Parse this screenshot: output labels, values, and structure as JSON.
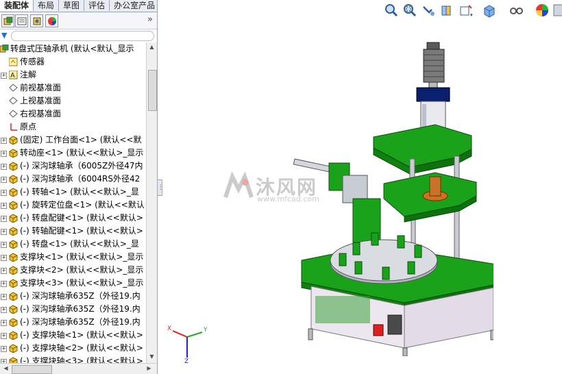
{
  "tabs": [
    {
      "label": "装配体",
      "active": true
    },
    {
      "label": "布局",
      "active": false
    },
    {
      "label": "草图",
      "active": false
    },
    {
      "label": "评估",
      "active": false
    },
    {
      "label": "办公室产品",
      "active": false
    }
  ],
  "panel_more": "»",
  "tree": [
    {
      "label": "转盘式压轴承机 (默认<默认_显示",
      "icon": "assembly-icon",
      "expand": "",
      "indent": 0
    },
    {
      "label": "传感器",
      "icon": "sensor-icon",
      "expand": "",
      "indent": 1
    },
    {
      "label": "注解",
      "icon": "annotation-icon",
      "expand": "+",
      "indent": 1
    },
    {
      "label": "前视基准面",
      "icon": "plane-icon",
      "expand": "",
      "indent": 1
    },
    {
      "label": "上视基准面",
      "icon": "plane-icon",
      "expand": "",
      "indent": 1
    },
    {
      "label": "右视基准面",
      "icon": "plane-icon",
      "expand": "",
      "indent": 1
    },
    {
      "label": "原点",
      "icon": "origin-icon",
      "expand": "",
      "indent": 1
    },
    {
      "label": "(固定) 工作台面<1> (默认<<默",
      "icon": "part-icon",
      "expand": "+",
      "indent": 1
    },
    {
      "label": "转动座<1> (默认<<默认>_显示",
      "icon": "part-icon",
      "expand": "+",
      "indent": 1
    },
    {
      "label": "(-) 深沟球轴承（6005Z外径47内",
      "icon": "part-icon",
      "expand": "+",
      "indent": 1
    },
    {
      "label": "(-) 深沟球轴承（6004RS外径42",
      "icon": "part-icon",
      "expand": "+",
      "indent": 1
    },
    {
      "label": "(-) 转轴<1> (默认<<默认>_显",
      "icon": "part-icon",
      "expand": "+",
      "indent": 1
    },
    {
      "label": "(-) 旋转定位盘<1> (默认<<默认",
      "icon": "part-icon",
      "expand": "+",
      "indent": 1
    },
    {
      "label": "(-) 转盘配键<1> (默认<<默认>",
      "icon": "part-icon",
      "expand": "+",
      "indent": 1
    },
    {
      "label": "(-) 转轴配键<1> (默认<<默认>",
      "icon": "part-icon",
      "expand": "+",
      "indent": 1
    },
    {
      "label": "(-) 转盘<1> (默认<<默认>_显",
      "icon": "part-icon",
      "expand": "+",
      "indent": 1
    },
    {
      "label": "支撑块<1> (默认<<默认>_显示",
      "icon": "part-icon",
      "expand": "+",
      "indent": 1
    },
    {
      "label": "支撑块<2> (默认<<默认>_显示",
      "icon": "part-icon",
      "expand": "+",
      "indent": 1
    },
    {
      "label": "支撑块<3> (默认<<默认>_显示",
      "icon": "part-icon",
      "expand": "+",
      "indent": 1
    },
    {
      "label": "(-) 深沟球轴承635Z（外径19.内",
      "icon": "part-icon",
      "expand": "+",
      "indent": 1
    },
    {
      "label": "(-) 深沟球轴承635Z（外径19.内",
      "icon": "part-icon",
      "expand": "+",
      "indent": 1
    },
    {
      "label": "(-) 深沟球轴承635Z（外径19.内",
      "icon": "part-icon",
      "expand": "+",
      "indent": 1
    },
    {
      "label": "(-) 支撑块轴<1> (默认<<默认>",
      "icon": "part-icon",
      "expand": "+",
      "indent": 1
    },
    {
      "label": "(-) 支撑块轴<2> (默认<<默认>",
      "icon": "part-icon",
      "expand": "+",
      "indent": 1
    },
    {
      "label": "(-) 支撑块轴<3> (默认<<默认>",
      "icon": "part-icon",
      "expand": "+",
      "indent": 1
    }
  ],
  "hud_icons": [
    "zoom-to-fit-icon",
    "zoom-to-area-icon",
    "previous-view-icon",
    "section-view-icon",
    "view-orientation-icon",
    "display-style-icon",
    "hide-show-items-icon",
    "appearance-icon"
  ],
  "watermark": {
    "text": "沐风网",
    "url": "www.mfcad.com"
  },
  "triad": {
    "x": "X",
    "y": "Y",
    "z": "Z"
  },
  "colors": {
    "frame_green": "#1aa21a",
    "panel_border": "#9aa6b8",
    "accent_blue": "#1f6fd1"
  }
}
